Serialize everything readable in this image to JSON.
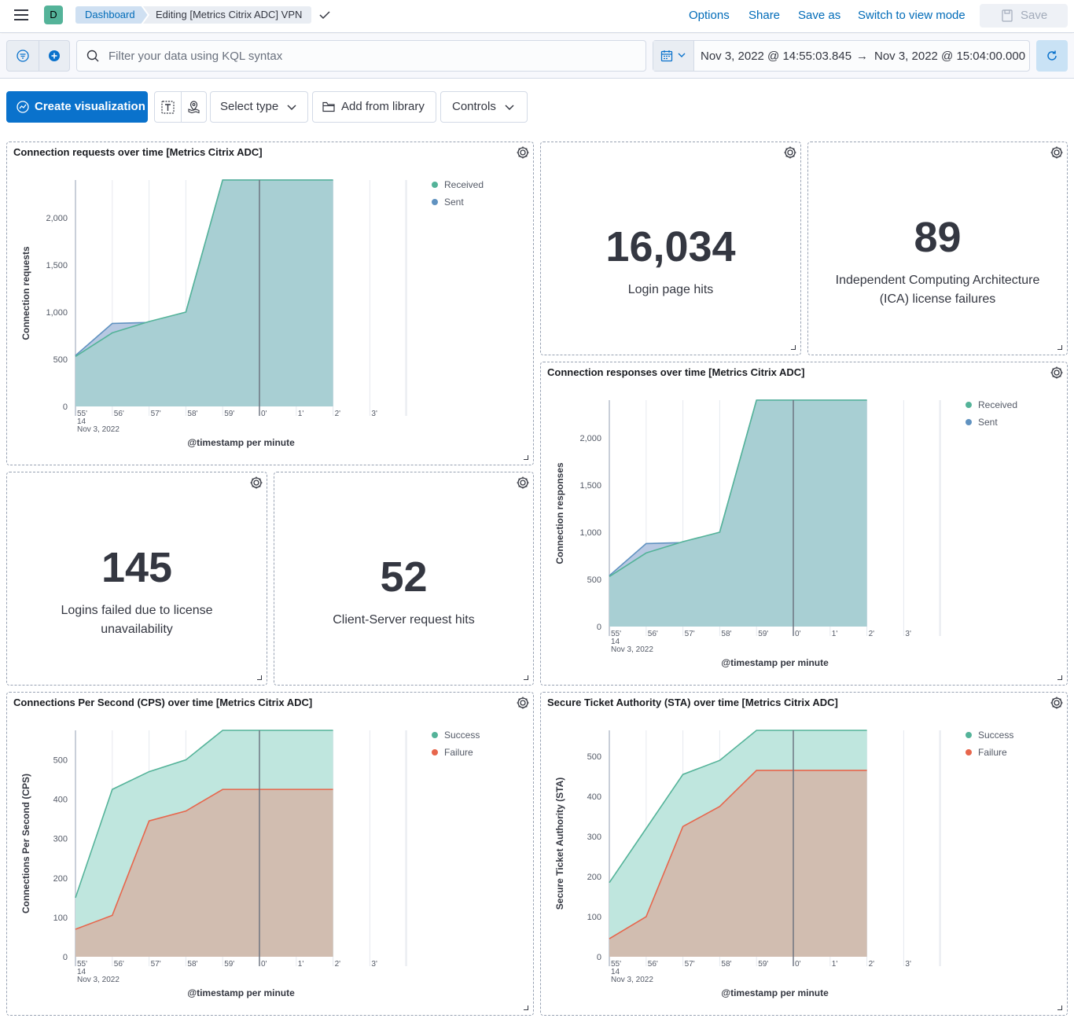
{
  "header": {
    "space_initial": "D",
    "breadcrumb_root": "Dashboard",
    "breadcrumb_current": "Editing [Metrics Citrix ADC] VPN",
    "options": "Options",
    "share": "Share",
    "save_as": "Save as",
    "switch_view": "Switch to view mode",
    "save": "Save"
  },
  "query": {
    "placeholder": "Filter your data using KQL syntax",
    "start": "Nov 3, 2022 @ 14:55:03.845",
    "arrow": "→",
    "end": "Nov 3, 2022 @ 15:04:00.000"
  },
  "toolbar": {
    "create": "Create visualization",
    "select_type": "Select type",
    "add_library": "Add from library",
    "controls": "Controls"
  },
  "metrics": {
    "login_hits": {
      "value": "16,034",
      "label": "Login page hits"
    },
    "ica_failures": {
      "value": "89",
      "label": "Independent Computing Architecture (ICA) license failures"
    },
    "logins_failed": {
      "value": "145",
      "label": "Logins failed due to license unavailability"
    },
    "cs_hits": {
      "value": "52",
      "label": "Client-Server request hits"
    }
  },
  "colors": {
    "received": "#54b399",
    "sent": "#6092c0",
    "success": "#54b399",
    "failure": "#e7664c"
  },
  "chart_data": [
    {
      "id": "conn_requests",
      "type": "area",
      "title": "Connection requests over time [Metrics Citrix ADC]",
      "ylabel": "Connection requests",
      "xlabel": "@timestamp per minute",
      "x": [
        "55'",
        "56'",
        "57'",
        "58'",
        "59'",
        "0'",
        "1'",
        "2'",
        "3'"
      ],
      "x_sub": [
        "14",
        "Nov 3, 2022"
      ],
      "yticks": [
        0,
        500,
        1000,
        1500,
        2000
      ],
      "ylim": [
        0,
        2400
      ],
      "series": [
        {
          "name": "Received",
          "values": [
            530,
            780,
            900,
            1000,
            2400,
            2400,
            2400,
            2400,
            null
          ]
        },
        {
          "name": "Sent",
          "values": [
            540,
            880,
            890,
            1000,
            2400,
            2400,
            2400,
            2400,
            null
          ]
        }
      ]
    },
    {
      "id": "conn_responses",
      "type": "area",
      "title": "Connection responses over time [Metrics Citrix ADC]",
      "ylabel": "Connection responses",
      "xlabel": "@timestamp per minute",
      "x": [
        "55'",
        "56'",
        "57'",
        "58'",
        "59'",
        "0'",
        "1'",
        "2'",
        "3'"
      ],
      "x_sub": [
        "14",
        "Nov 3, 2022"
      ],
      "yticks": [
        0,
        500,
        1000,
        1500,
        2000
      ],
      "ylim": [
        0,
        2400
      ],
      "series": [
        {
          "name": "Received",
          "values": [
            530,
            780,
            900,
            1000,
            2400,
            2400,
            2400,
            2400,
            null
          ]
        },
        {
          "name": "Sent",
          "values": [
            540,
            880,
            890,
            1000,
            2400,
            2400,
            2400,
            2400,
            null
          ]
        }
      ]
    },
    {
      "id": "cps",
      "type": "area",
      "title": "Connections Per Second (CPS) over time [Metrics Citrix ADC]",
      "ylabel": "Connections Per Second (CPS)",
      "xlabel": "@timestamp per minute",
      "x": [
        "55'",
        "56'",
        "57'",
        "58'",
        "59'",
        "0'",
        "1'",
        "2'",
        "3'"
      ],
      "x_sub": [
        "14",
        "Nov 3, 2022"
      ],
      "yticks": [
        0,
        100,
        200,
        300,
        400,
        500
      ],
      "ylim": [
        0,
        575
      ],
      "series": [
        {
          "name": "Success",
          "values": [
            150,
            425,
            470,
            500,
            575,
            575,
            575,
            575,
            null
          ]
        },
        {
          "name": "Failure",
          "values": [
            70,
            105,
            345,
            370,
            425,
            425,
            425,
            425,
            null
          ]
        }
      ]
    },
    {
      "id": "sta",
      "type": "area",
      "title": "Secure Ticket Authority (STA) over time [Metrics Citrix ADC]",
      "ylabel": "Secure Ticket Authority (STA)",
      "xlabel": "@timestamp per minute",
      "x": [
        "55'",
        "56'",
        "57'",
        "58'",
        "59'",
        "0'",
        "1'",
        "2'",
        "3'"
      ],
      "x_sub": [
        "14",
        "Nov 3, 2022"
      ],
      "yticks": [
        0,
        100,
        200,
        300,
        400,
        500
      ],
      "ylim": [
        0,
        565
      ],
      "series": [
        {
          "name": "Success",
          "values": [
            185,
            320,
            455,
            490,
            565,
            565,
            565,
            565,
            null
          ]
        },
        {
          "name": "Failure",
          "values": [
            45,
            100,
            325,
            375,
            465,
            465,
            465,
            465,
            null
          ]
        }
      ]
    }
  ]
}
